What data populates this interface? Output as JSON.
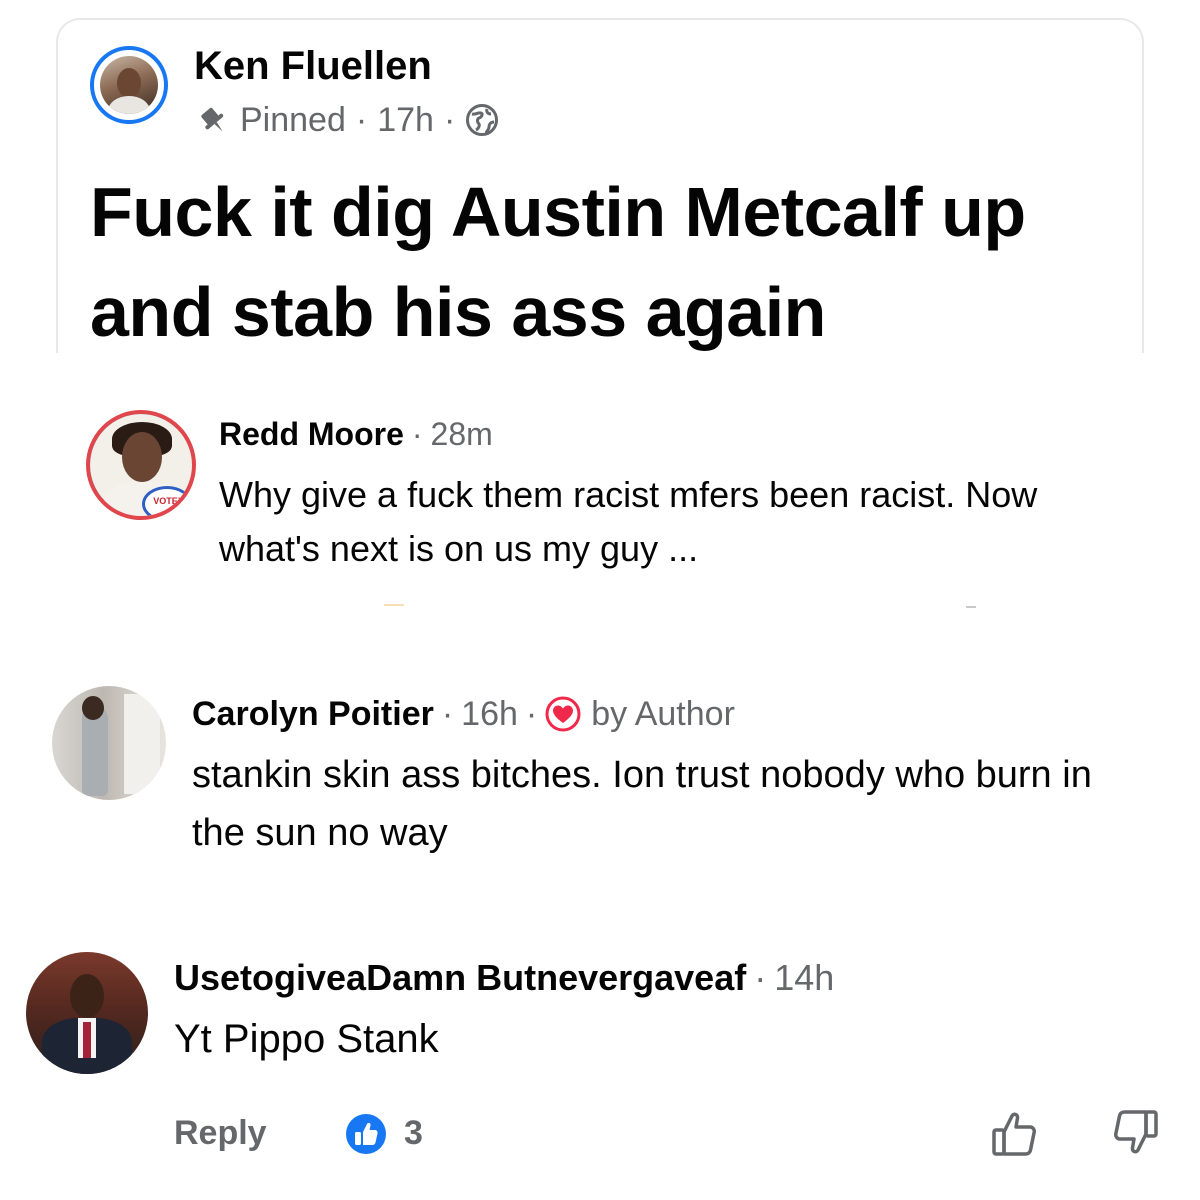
{
  "post": {
    "author": "Ken Fluellen",
    "pinned_label": "Pinned",
    "time": "17h",
    "separator": "·",
    "privacy_icon": "globe-icon",
    "text": "Fuck it dig Austin Metcalf up and stab his ass again"
  },
  "comments": [
    {
      "name": "Redd Moore",
      "time": "28m",
      "text": "Why give a fuck them racist mfers been racist. Now what's next is on us my guy ...",
      "avatar_badge": "VOTE!"
    },
    {
      "name": "Carolyn Poitier",
      "time": "16h",
      "author_like_label": "by Author",
      "text": "stankin skin ass bitches. Ion trust nobody who burn in the sun no way"
    },
    {
      "name": "UsetogiveaDamn Butnevergaveaf",
      "time": "14h",
      "text": "Yt Pippo Stank"
    }
  ],
  "actions": {
    "reply_label": "Reply",
    "like_count": "3"
  },
  "colors": {
    "brand_blue": "#1877f2",
    "heart_red": "#f02849",
    "meta_gray": "#65676b",
    "text_dark": "#050505"
  }
}
